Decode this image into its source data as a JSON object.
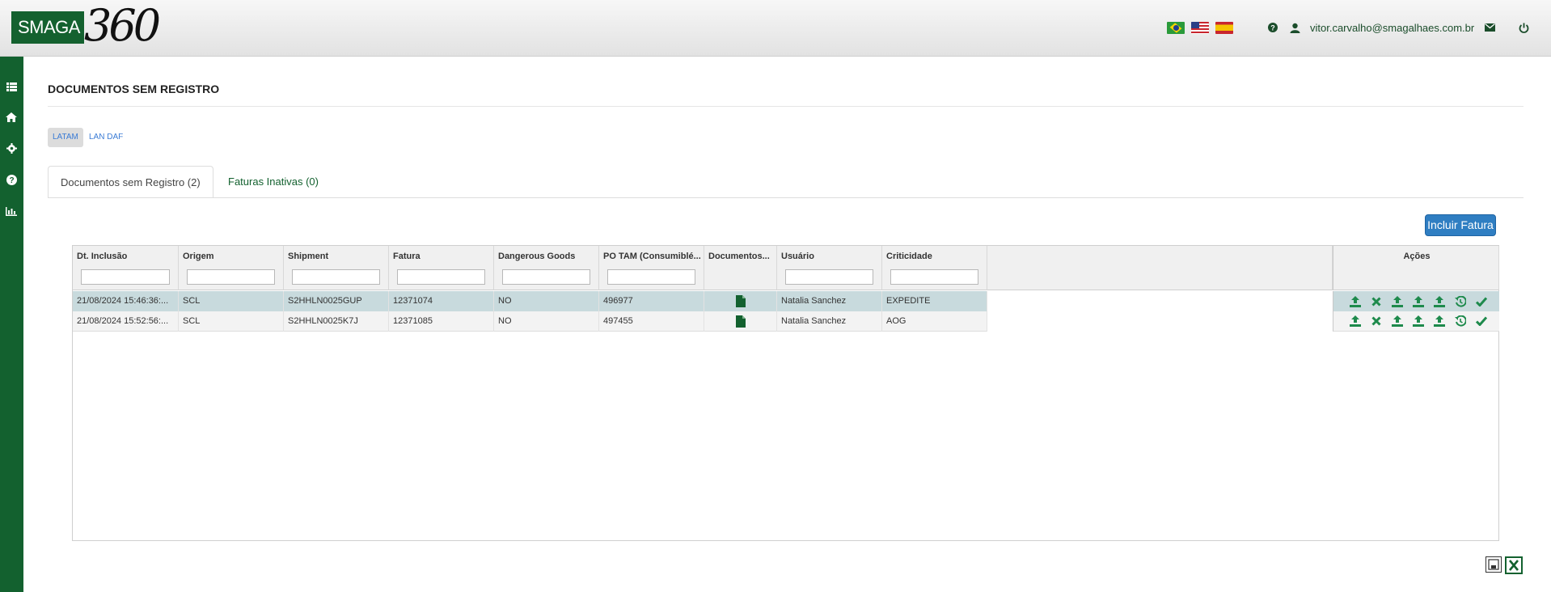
{
  "header": {
    "logo_text": "SMAGA",
    "logo_suffix": "360",
    "languages": [
      "pt-BR",
      "en-US",
      "es-ES"
    ],
    "user_email": "vitor.carvalho@smagalhaes.com.br"
  },
  "sidebar": {
    "items": [
      "list-icon",
      "home-icon",
      "gear-icon",
      "help-icon",
      "chart-icon"
    ]
  },
  "page": {
    "title": "DOCUMENTOS SEM REGISTRO"
  },
  "filters": {
    "pills": [
      "LATAM",
      "LAN DAF"
    ],
    "active": "LATAM"
  },
  "tabs": [
    {
      "label": "Documentos sem Registro (2)",
      "active": true
    },
    {
      "label": "Faturas Inativas (0)",
      "active": false
    }
  ],
  "toolbar": {
    "add_label": "Incluir Fatura"
  },
  "grid": {
    "columns": [
      "Dt. Inclusão",
      "Origem",
      "Shipment",
      "Fatura",
      "Dangerous Goods",
      "PO TAM (Consumiblé...",
      "Documentos...",
      "Usuário",
      "Criticidade"
    ],
    "actions_header": "Ações",
    "rows": [
      {
        "dt": "21/08/2024 15:46:36:...",
        "origem": "SCL",
        "shipment": "S2HHLN0025GUP",
        "fatura": "12371074",
        "dg": "NO",
        "po": "496977",
        "usuario": "Natalia Sanchez",
        "criticidade": "EXPEDITE",
        "selected": true
      },
      {
        "dt": "21/08/2024 15:52:56:...",
        "origem": "SCL",
        "shipment": "S2HHLN0025K7J",
        "fatura": "12371085",
        "dg": "NO",
        "po": "497455",
        "usuario": "Natalia Sanchez",
        "criticidade": "AOG",
        "selected": false
      }
    ]
  },
  "colors": {
    "brand_green": "#13612f",
    "primary_blue": "#2f7ec2",
    "selected_row": "#c8dadd",
    "action_green": "#1e8a4c"
  }
}
